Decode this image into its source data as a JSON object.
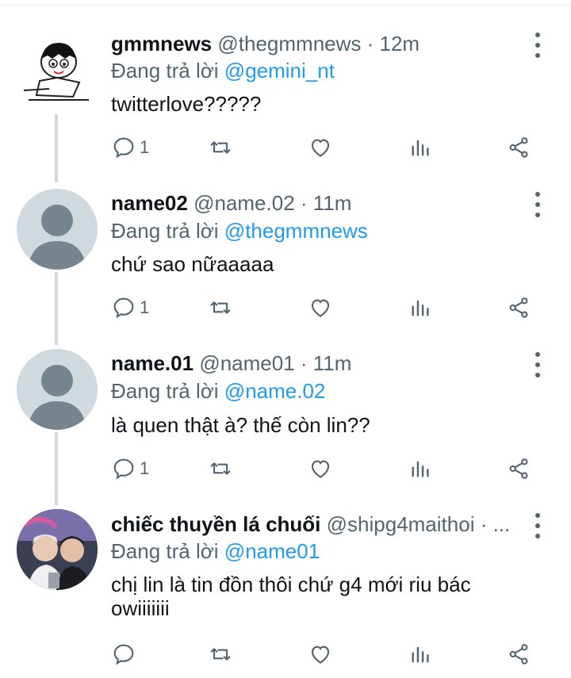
{
  "tweets": [
    {
      "name": "gmmnews",
      "handle": "@thegmmnews · 12m",
      "reply_prefix": "Đang trả lời",
      "reply_to": "@gemini_nt",
      "text": "twitterlove?????",
      "reply_count": "1",
      "avatar": "cartoon-avatar"
    },
    {
      "name": "name02",
      "handle": "@name.02 · 11m",
      "reply_prefix": "Đang trả lời",
      "reply_to": "@thegmmnews",
      "text": "chứ sao nữaaaaa",
      "reply_count": "1",
      "avatar": "default-avatar"
    },
    {
      "name": "name.01",
      "handle": "@name01 · 11m",
      "reply_prefix": "Đang trả lời",
      "reply_to": "@name.02",
      "text": "là quen thật à? thế còn lin??",
      "reply_count": "1",
      "avatar": "default-avatar"
    },
    {
      "name": "chiếc thuyền lá chuối",
      "handle": "@shipg4maithoi · ...",
      "reply_prefix": "Đang trả lời",
      "reply_to": "@name01",
      "text": "chị lin là tin đồn thôi chứ g4 mới riu bác owiiiiiii",
      "reply_count": "",
      "avatar": "photo-avatar"
    }
  ],
  "colors": {
    "link": "#1d9bf0",
    "secondary": "#536471",
    "thread_line": "#cfd9de"
  }
}
